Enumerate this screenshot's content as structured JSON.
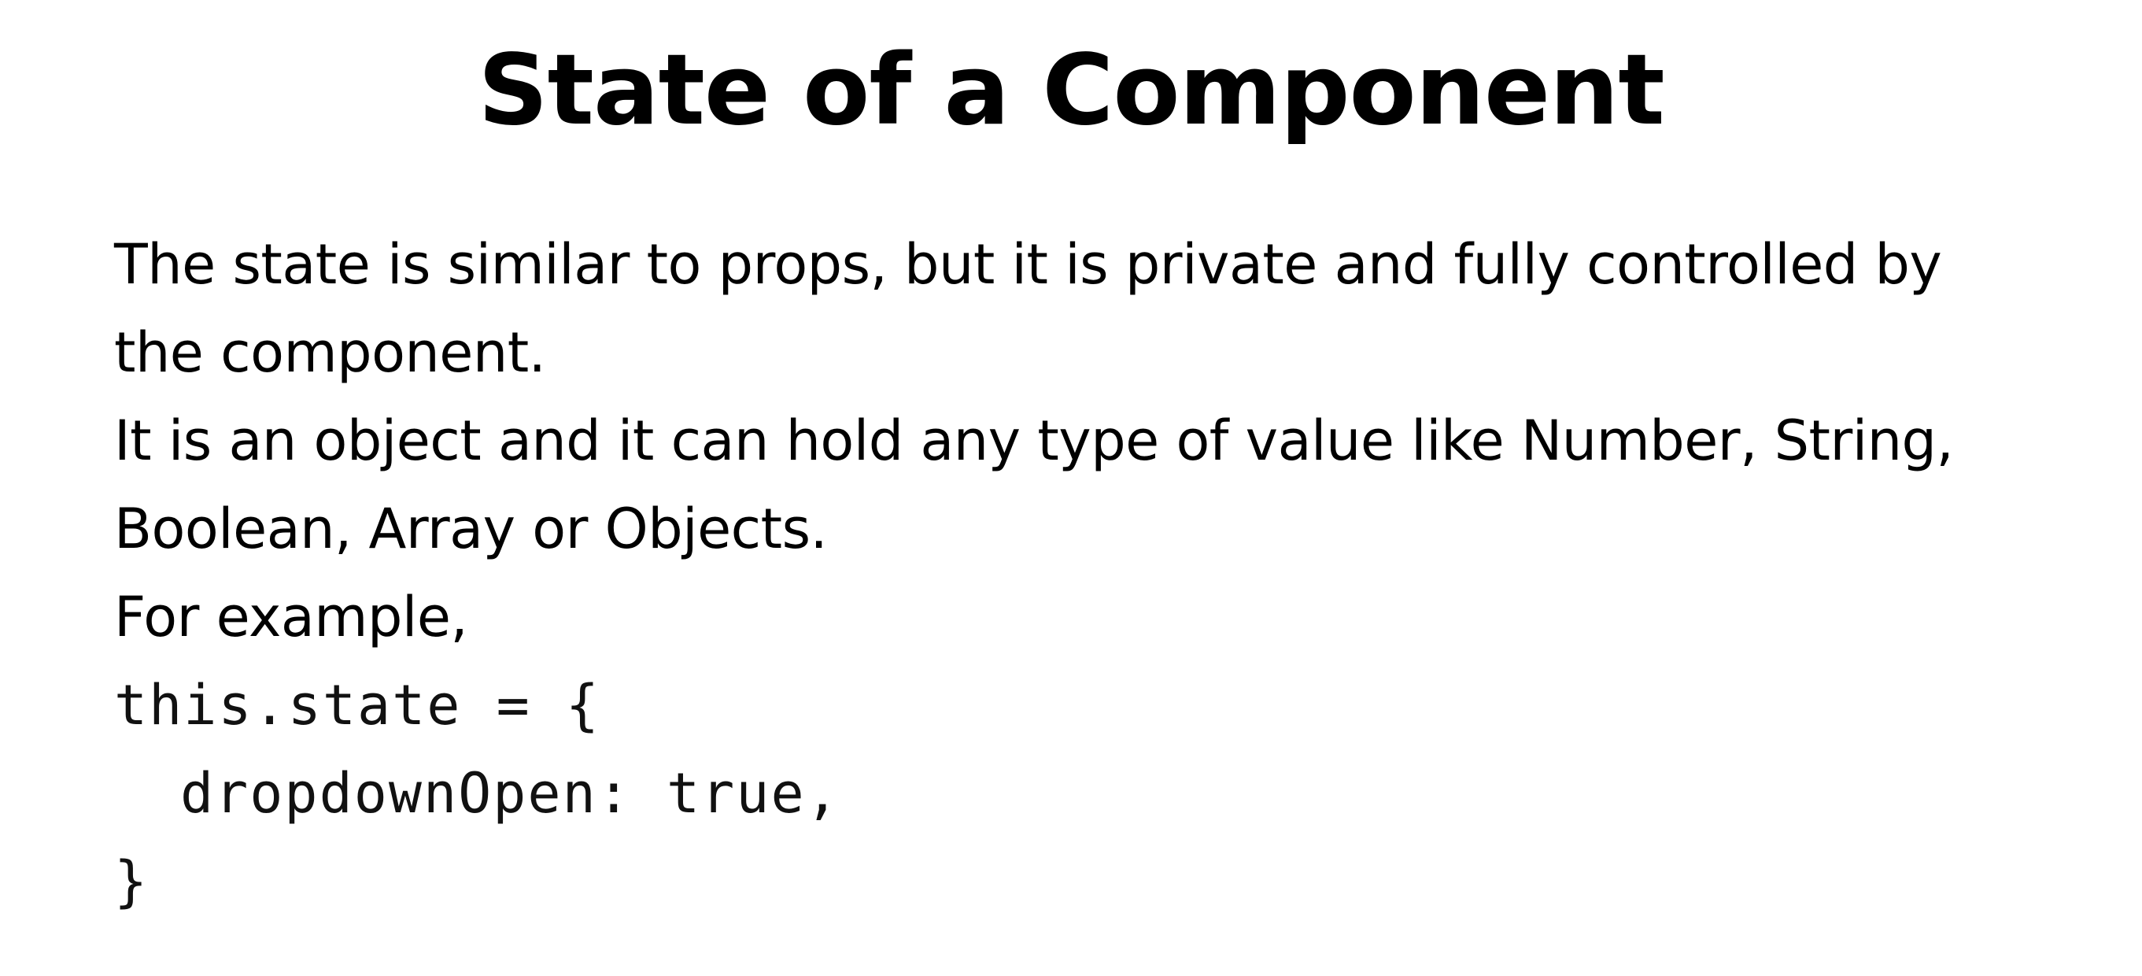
{
  "slide": {
    "title": "State of a Component",
    "paragraphs": [
      "The state is similar to props, but it is private and fully controlled by",
      "the component.",
      "It is an object and it can hold any type of value like Number, String,",
      "Boolean, Array or Objects.",
      "For example,"
    ],
    "code": [
      "this.state = {",
      "dropdownOpen: true,",
      "}"
    ]
  }
}
